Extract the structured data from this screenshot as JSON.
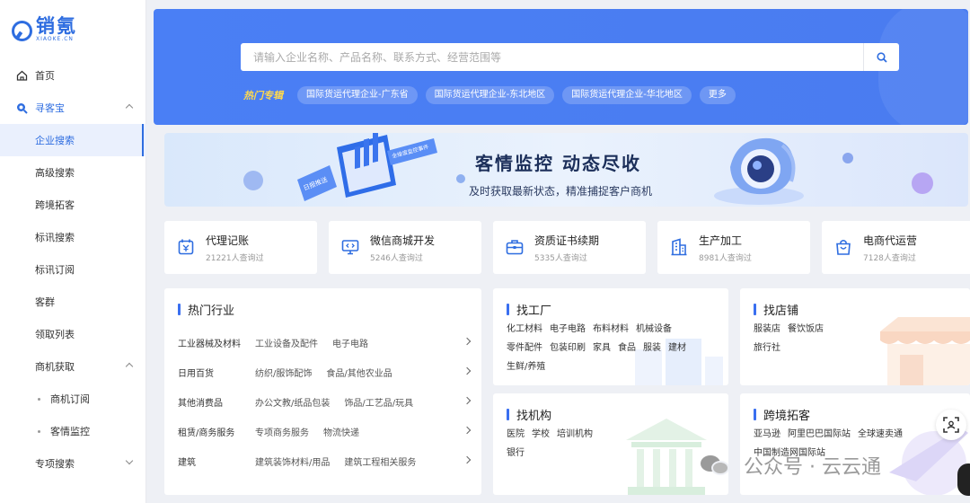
{
  "brand": {
    "name_cn": "销氪",
    "name_en": "XIAOKE.CN",
    "color": "#2e6de0"
  },
  "sidebar": {
    "items": [
      {
        "label": "首页",
        "icon": "home-icon"
      },
      {
        "label": "寻客宝",
        "icon": "search-icon",
        "expanded": true
      },
      {
        "label": "企业搜索",
        "active": true
      },
      {
        "label": "高级搜索"
      },
      {
        "label": "跨境拓客"
      },
      {
        "label": "标讯搜索"
      },
      {
        "label": "标讯订阅"
      },
      {
        "label": "客群"
      },
      {
        "label": "领取列表"
      },
      {
        "label": "商机获取",
        "expanded": true
      },
      {
        "label": "商机订阅"
      },
      {
        "label": "客情监控"
      },
      {
        "label": "专项搜索",
        "expanded": false
      }
    ]
  },
  "search": {
    "placeholder": "请输入企业名称、产品名称、联系方式、经营范围等"
  },
  "hot": {
    "title": "热门专辑",
    "chips": [
      "国际货运代理企业-广东省",
      "国际货运代理企业-东北地区",
      "国际货运代理企业-华北地区",
      "更多"
    ]
  },
  "banner": {
    "title": "客情监控 动态尽收",
    "subtitle": "及时获取最新状态，精准捕捉客户商机",
    "tag1": "日报推送",
    "tag2": "全维度监控事件"
  },
  "services": [
    {
      "title": "代理记账",
      "sub": "21221人查询过",
      "icon": "calendar-yuan-icon"
    },
    {
      "title": "微信商城开发",
      "sub": "5246人查询过",
      "icon": "code-monitor-icon"
    },
    {
      "title": "资质证书续期",
      "sub": "5335人查询过",
      "icon": "briefcase-icon"
    },
    {
      "title": "生产加工",
      "sub": "8981人查询过",
      "icon": "building-icon"
    },
    {
      "title": "电商代运营",
      "sub": "7128人查询过",
      "icon": "shopping-bag-icon"
    }
  ],
  "industry": {
    "title": "热门行业",
    "rows": [
      [
        "工业器械及材料",
        "工业设备及配件",
        "电子电路"
      ],
      [
        "日用百货",
        "纺织/服饰配饰",
        "食品/其他农业品"
      ],
      [
        "其他消费品",
        "办公文教/纸品包装",
        "饰品/工艺品/玩具"
      ],
      [
        "租赁/商务服务",
        "专项商务服务",
        "物流快递"
      ],
      [
        "建筑",
        "建筑装饰材料/用品",
        "建筑工程相关服务"
      ]
    ]
  },
  "factory": {
    "title": "找工厂",
    "lines": [
      [
        "化工材料",
        "电子电路",
        "布料材料",
        "机械设备"
      ],
      [
        "零件配件",
        "包装印刷",
        "家具",
        "食品",
        "服装",
        "建材"
      ],
      [
        "生鲜/养殖"
      ]
    ]
  },
  "shop": {
    "title": "找店铺",
    "lines": [
      [
        "服装店",
        "餐饮饭店"
      ],
      [
        "旅行社"
      ]
    ]
  },
  "org": {
    "title": "找机构",
    "lines": [
      [
        "医院",
        "学校",
        "培训机构"
      ],
      [
        "银行"
      ]
    ]
  },
  "cross": {
    "title": "跨境拓客",
    "lines": [
      [
        "亚马逊",
        "阿里巴巴国际站",
        "全球速卖通"
      ],
      [
        "中国制造网国际站"
      ]
    ]
  },
  "watermark": {
    "text": "公众号 · 云云通"
  },
  "colors": {
    "hero": "#4a7ff5",
    "accent": "#2e6de0",
    "hot_title": "#ffd94d"
  }
}
